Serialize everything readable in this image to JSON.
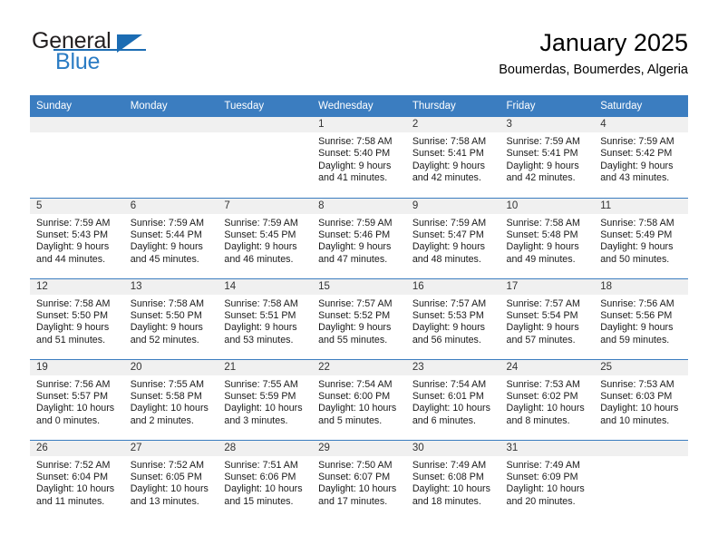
{
  "brand": {
    "name_part1": "General",
    "name_part2": "Blue",
    "triangle_icon": "triangle-icon"
  },
  "header": {
    "title": "January 2025",
    "subtitle": "Boumerdas, Boumerdes, Algeria"
  },
  "calendar": {
    "weekday_headers": [
      "Sunday",
      "Monday",
      "Tuesday",
      "Wednesday",
      "Thursday",
      "Friday",
      "Saturday"
    ],
    "accent_color": "#3b7dc0",
    "daynum_strip_color": "#f0f0f0",
    "weeks": [
      [
        {
          "day": "",
          "lines": []
        },
        {
          "day": "",
          "lines": []
        },
        {
          "day": "",
          "lines": []
        },
        {
          "day": "1",
          "lines": [
            "Sunrise: 7:58 AM",
            "Sunset: 5:40 PM",
            "Daylight: 9 hours",
            "and 41 minutes."
          ]
        },
        {
          "day": "2",
          "lines": [
            "Sunrise: 7:58 AM",
            "Sunset: 5:41 PM",
            "Daylight: 9 hours",
            "and 42 minutes."
          ]
        },
        {
          "day": "3",
          "lines": [
            "Sunrise: 7:59 AM",
            "Sunset: 5:41 PM",
            "Daylight: 9 hours",
            "and 42 minutes."
          ]
        },
        {
          "day": "4",
          "lines": [
            "Sunrise: 7:59 AM",
            "Sunset: 5:42 PM",
            "Daylight: 9 hours",
            "and 43 minutes."
          ]
        }
      ],
      [
        {
          "day": "5",
          "lines": [
            "Sunrise: 7:59 AM",
            "Sunset: 5:43 PM",
            "Daylight: 9 hours",
            "and 44 minutes."
          ]
        },
        {
          "day": "6",
          "lines": [
            "Sunrise: 7:59 AM",
            "Sunset: 5:44 PM",
            "Daylight: 9 hours",
            "and 45 minutes."
          ]
        },
        {
          "day": "7",
          "lines": [
            "Sunrise: 7:59 AM",
            "Sunset: 5:45 PM",
            "Daylight: 9 hours",
            "and 46 minutes."
          ]
        },
        {
          "day": "8",
          "lines": [
            "Sunrise: 7:59 AM",
            "Sunset: 5:46 PM",
            "Daylight: 9 hours",
            "and 47 minutes."
          ]
        },
        {
          "day": "9",
          "lines": [
            "Sunrise: 7:59 AM",
            "Sunset: 5:47 PM",
            "Daylight: 9 hours",
            "and 48 minutes."
          ]
        },
        {
          "day": "10",
          "lines": [
            "Sunrise: 7:58 AM",
            "Sunset: 5:48 PM",
            "Daylight: 9 hours",
            "and 49 minutes."
          ]
        },
        {
          "day": "11",
          "lines": [
            "Sunrise: 7:58 AM",
            "Sunset: 5:49 PM",
            "Daylight: 9 hours",
            "and 50 minutes."
          ]
        }
      ],
      [
        {
          "day": "12",
          "lines": [
            "Sunrise: 7:58 AM",
            "Sunset: 5:50 PM",
            "Daylight: 9 hours",
            "and 51 minutes."
          ]
        },
        {
          "day": "13",
          "lines": [
            "Sunrise: 7:58 AM",
            "Sunset: 5:50 PM",
            "Daylight: 9 hours",
            "and 52 minutes."
          ]
        },
        {
          "day": "14",
          "lines": [
            "Sunrise: 7:58 AM",
            "Sunset: 5:51 PM",
            "Daylight: 9 hours",
            "and 53 minutes."
          ]
        },
        {
          "day": "15",
          "lines": [
            "Sunrise: 7:57 AM",
            "Sunset: 5:52 PM",
            "Daylight: 9 hours",
            "and 55 minutes."
          ]
        },
        {
          "day": "16",
          "lines": [
            "Sunrise: 7:57 AM",
            "Sunset: 5:53 PM",
            "Daylight: 9 hours",
            "and 56 minutes."
          ]
        },
        {
          "day": "17",
          "lines": [
            "Sunrise: 7:57 AM",
            "Sunset: 5:54 PM",
            "Daylight: 9 hours",
            "and 57 minutes."
          ]
        },
        {
          "day": "18",
          "lines": [
            "Sunrise: 7:56 AM",
            "Sunset: 5:56 PM",
            "Daylight: 9 hours",
            "and 59 minutes."
          ]
        }
      ],
      [
        {
          "day": "19",
          "lines": [
            "Sunrise: 7:56 AM",
            "Sunset: 5:57 PM",
            "Daylight: 10 hours",
            "and 0 minutes."
          ]
        },
        {
          "day": "20",
          "lines": [
            "Sunrise: 7:55 AM",
            "Sunset: 5:58 PM",
            "Daylight: 10 hours",
            "and 2 minutes."
          ]
        },
        {
          "day": "21",
          "lines": [
            "Sunrise: 7:55 AM",
            "Sunset: 5:59 PM",
            "Daylight: 10 hours",
            "and 3 minutes."
          ]
        },
        {
          "day": "22",
          "lines": [
            "Sunrise: 7:54 AM",
            "Sunset: 6:00 PM",
            "Daylight: 10 hours",
            "and 5 minutes."
          ]
        },
        {
          "day": "23",
          "lines": [
            "Sunrise: 7:54 AM",
            "Sunset: 6:01 PM",
            "Daylight: 10 hours",
            "and 6 minutes."
          ]
        },
        {
          "day": "24",
          "lines": [
            "Sunrise: 7:53 AM",
            "Sunset: 6:02 PM",
            "Daylight: 10 hours",
            "and 8 minutes."
          ]
        },
        {
          "day": "25",
          "lines": [
            "Sunrise: 7:53 AM",
            "Sunset: 6:03 PM",
            "Daylight: 10 hours",
            "and 10 minutes."
          ]
        }
      ],
      [
        {
          "day": "26",
          "lines": [
            "Sunrise: 7:52 AM",
            "Sunset: 6:04 PM",
            "Daylight: 10 hours",
            "and 11 minutes."
          ]
        },
        {
          "day": "27",
          "lines": [
            "Sunrise: 7:52 AM",
            "Sunset: 6:05 PM",
            "Daylight: 10 hours",
            "and 13 minutes."
          ]
        },
        {
          "day": "28",
          "lines": [
            "Sunrise: 7:51 AM",
            "Sunset: 6:06 PM",
            "Daylight: 10 hours",
            "and 15 minutes."
          ]
        },
        {
          "day": "29",
          "lines": [
            "Sunrise: 7:50 AM",
            "Sunset: 6:07 PM",
            "Daylight: 10 hours",
            "and 17 minutes."
          ]
        },
        {
          "day": "30",
          "lines": [
            "Sunrise: 7:49 AM",
            "Sunset: 6:08 PM",
            "Daylight: 10 hours",
            "and 18 minutes."
          ]
        },
        {
          "day": "31",
          "lines": [
            "Sunrise: 7:49 AM",
            "Sunset: 6:09 PM",
            "Daylight: 10 hours",
            "and 20 minutes."
          ]
        },
        {
          "day": "",
          "lines": []
        }
      ]
    ]
  }
}
